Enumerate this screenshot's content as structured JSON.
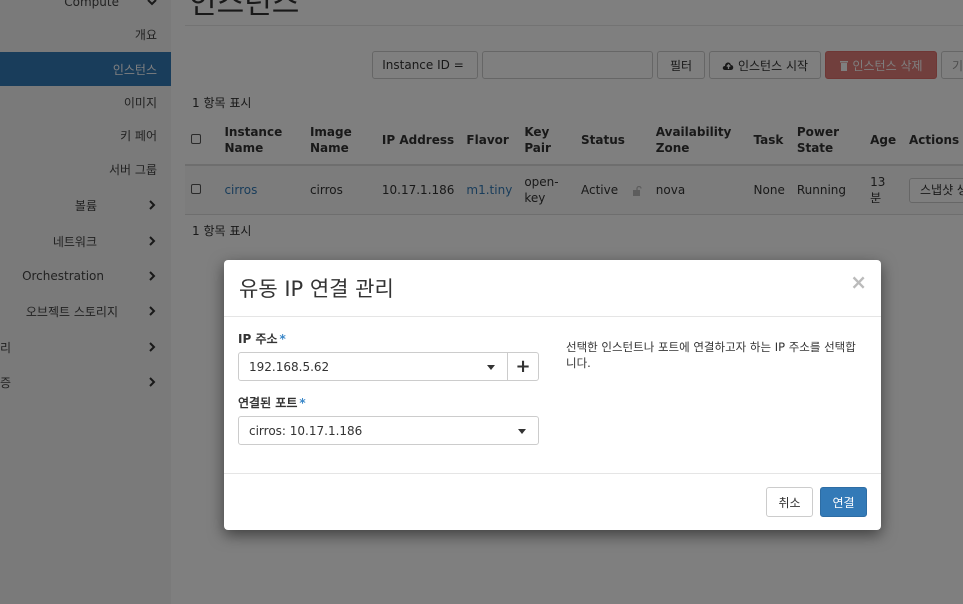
{
  "sidebar": {
    "compute": "Compute",
    "items": [
      {
        "label": "개요"
      },
      {
        "label": "인스턴스"
      },
      {
        "label": "이미지"
      },
      {
        "label": "키 페어"
      },
      {
        "label": "서버 그룹"
      }
    ],
    "groups": [
      {
        "label": "볼륨"
      },
      {
        "label": "네트워크"
      },
      {
        "label": "Orchestration"
      },
      {
        "label": "오브젝트 스토리지"
      },
      {
        "label": "리"
      },
      {
        "label": "증"
      }
    ]
  },
  "main": {
    "title": "인스턴스",
    "toolbar": {
      "filter_select": "Instance ID =",
      "filter_btn": "필터",
      "launch_btn": "인스턴스 시작",
      "delete_btn": "인스턴스 삭제",
      "more_btn": "기"
    },
    "count_label": "1 항목 표시",
    "table": {
      "headers": [
        "Instance Name",
        "Image Name",
        "IP Address",
        "Flavor",
        "Key Pair",
        "Status",
        "Availability Zone",
        "Task",
        "Power State",
        "Age",
        "Actions"
      ],
      "rows": [
        {
          "instance_name": "cirros",
          "image_name": "cirros",
          "ip_address": "10.17.1.186",
          "flavor": "m1.tiny",
          "key_pair": "open-key",
          "status": "Active",
          "availability_zone": "nova",
          "task": "None",
          "power_state": "Running",
          "age": "13 분",
          "action": "스냅샷 생"
        }
      ]
    }
  },
  "modal": {
    "title": "유동 IP 연결 관리",
    "close": "×",
    "ip_label": "IP 주소",
    "ip_value": "192.168.5.62",
    "add": "+",
    "port_label": "연결된 포트",
    "port_value": "cirros: 10.17.1.186",
    "required_mark": "*",
    "help": "선택한 인스턴트나 포트에 연결하고자 하는 IP 주소를 선택합니다.",
    "cancel": "취소",
    "connect": "연결"
  }
}
